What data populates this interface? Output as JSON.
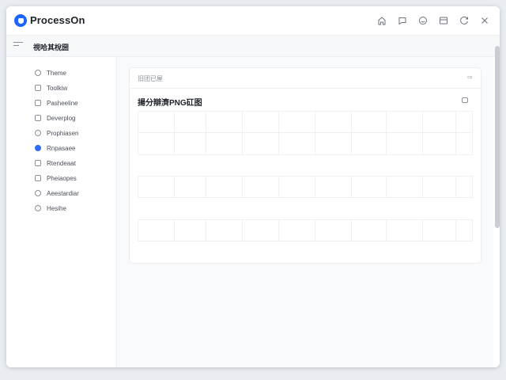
{
  "app": {
    "title": "ProcessOn"
  },
  "titlebar": {
    "icons": [
      "home-icon",
      "chat-icon",
      "smile-icon",
      "window-icon",
      "refresh-icon",
      "close-icon"
    ]
  },
  "header": {
    "page_title": "視哈其梲圀"
  },
  "sidebar": {
    "items": [
      {
        "label": "Theme",
        "icon": "palette-icon"
      },
      {
        "label": "Toolkiw",
        "icon": "toolkit-icon"
      },
      {
        "label": "Pasheeline",
        "icon": "pipeline-icon"
      },
      {
        "label": "Deverplog",
        "icon": "developer-icon"
      },
      {
        "label": "Prophiasen",
        "icon": "profile-icon"
      },
      {
        "label": "Rnpasaee",
        "icon": "resource-icon",
        "active": true
      },
      {
        "label": "Rtendeaat",
        "icon": "attendance-icon"
      },
      {
        "label": "Pheiaopes",
        "icon": "phone-icon"
      },
      {
        "label": "Aeestardiar",
        "icon": "calendar-icon"
      },
      {
        "label": "Hesihe",
        "icon": "help-icon"
      }
    ]
  },
  "card": {
    "header_label": "旧团已屋",
    "header_action": "⇨",
    "title": "揚分辯濟PNG矼图"
  },
  "colors": {
    "accent": "#2f6bff",
    "logo": "#1e64ff"
  }
}
